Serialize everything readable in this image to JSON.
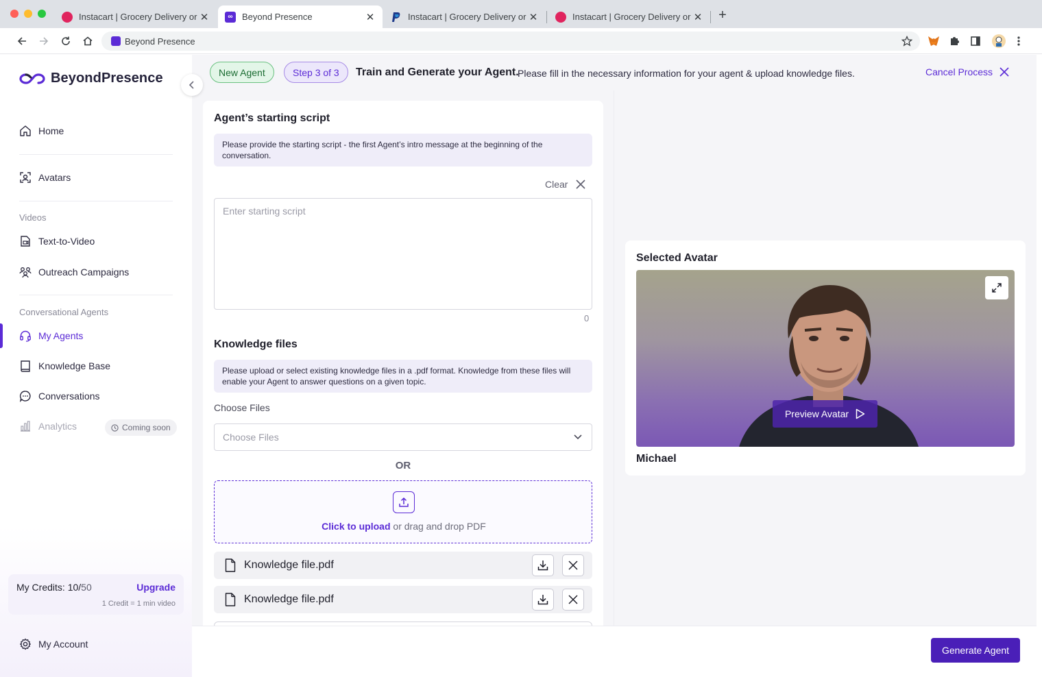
{
  "browser": {
    "tabs": [
      {
        "title": "Instacart | Grocery Delivery or",
        "favicon": "instacart-favicon",
        "color": "#e0245e",
        "active": false
      },
      {
        "title": "Beyond Presence",
        "favicon": "beyond-presence-favicon",
        "color": "#5b2bd6",
        "active": true
      },
      {
        "title": "Instacart | Grocery Delivery or",
        "favicon": "paypal-favicon",
        "color": "#1e3a8a",
        "active": false
      },
      {
        "title": "Instacart | Grocery Delivery or",
        "favicon": "instacart-favicon",
        "color": "#e0245e",
        "active": false
      }
    ],
    "address": "Beyond Presence"
  },
  "sidebar": {
    "logo": "BeyondPresence",
    "items": {
      "home": "Home",
      "avatars": "Avatars",
      "videos_section": "Videos",
      "text_to_video": "Text-to-Video",
      "outreach": "Outreach Campaigns",
      "agents_section": "Conversational Agents",
      "my_agents": "My Agents",
      "knowledge_base": "Knowledge Base",
      "conversations": "Conversations",
      "analytics": "Analytics",
      "coming_soon": "Coming soon"
    },
    "credits": {
      "label": "My Credits:",
      "used": "10/",
      "max": "50",
      "upgrade": "Upgrade",
      "note": "1 Credit = 1 min video"
    },
    "account": "My Account"
  },
  "header": {
    "badge_new": "New Agent",
    "badge_step": "Step 3 of 3",
    "title": "Train and Generate your Agent.",
    "description": "Please fill in the necessary information for your agent & upload knowledge files.",
    "cancel": "Cancel Process"
  },
  "script": {
    "title": "Agent’s starting script",
    "info": "Please provide the starting script - the first Agent’s intro message at the beginning of the conversation.",
    "clear": "Clear",
    "placeholder": "Enter starting script",
    "value": "",
    "char_count": "0"
  },
  "knowledge": {
    "title": "Knowledge files",
    "info": "Please upload or select existing knowledge files in a .pdf format. Knowledge from these files will enable your Agent to answer questions on a given topic.",
    "choose_label": "Choose Files",
    "choose_placeholder": "Choose Files",
    "or": "OR",
    "upload_link": "Click to upload",
    "upload_rest": "or drag and drop PDF",
    "files": [
      "Knowledge file.pdf",
      "Knowledge file.pdf"
    ]
  },
  "avatar": {
    "title": "Selected Avatar",
    "preview": "Preview Avatar",
    "name": "Michael"
  },
  "footer": {
    "generate": "Generate Agent"
  },
  "colors": {
    "accent": "#5b2bd6",
    "primary_button": "#4a1fb8",
    "success_badge": "#e3f6e8"
  }
}
